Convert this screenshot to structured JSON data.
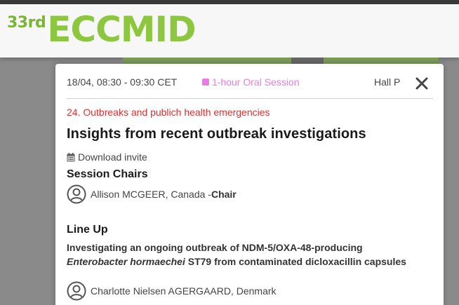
{
  "header": {
    "logo_sup": "33rd",
    "logo_main": "ECCMID",
    "ghost_text_1": "",
    "ghost_text_2": ""
  },
  "session": {
    "time": "18/04, 08:30 - 09:30 CET",
    "type": "1-hour Oral Session",
    "hall": "Hall P",
    "category": "24. Outbreaks and publich health emergencies",
    "title": "Insights from recent outbreak investigations",
    "download_label": "Download invite"
  },
  "chairs": {
    "heading": "Session Chairs",
    "items": [
      {
        "name": "Allison MCGEER, Canada - ",
        "role": "Chair"
      }
    ]
  },
  "lineup": {
    "heading": "Line Up",
    "talks": [
      {
        "title_part1": "Investigating an ongoing outbreak of NDM-5/OXA-48-producing",
        "title_italic": "Enterobacter hormaechei",
        "title_part2": " ST79 from contaminated dicloxacillin capsules",
        "speaker": "Charlotte Nielsen AGERGAARD, Denmark"
      }
    ]
  },
  "colors": {
    "brand_green": "#8dc63f",
    "session_type_pink": "#e87ce0",
    "category_red": "#e02e2e"
  },
  "icons": {
    "close": "close-icon",
    "calendar": "calendar-icon",
    "person": "user-circle-icon"
  }
}
